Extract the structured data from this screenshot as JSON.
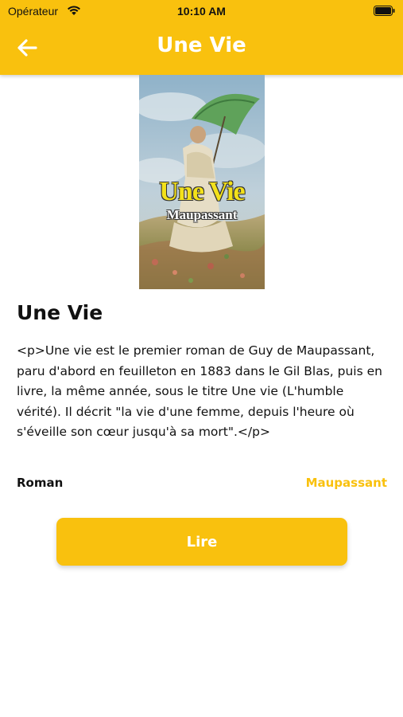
{
  "status_bar": {
    "carrier": "Opérateur",
    "time": "10:10 AM"
  },
  "nav": {
    "title": "Une Vie",
    "back_icon": "arrow-left-icon"
  },
  "cover": {
    "title": "Une Vie",
    "author": "Maupassant"
  },
  "book": {
    "title": "Une Vie",
    "description": "<p>Une vie est le premier roman de Guy de Maupassant, paru d'abord en feuilleton en 1883 dans le Gil Blas, puis en livre, la même année, sous le titre Une vie (L'humble vérité). Il décrit \"la vie d'une femme, depuis l'heure où s'éveille son cœur jusqu'à sa mort\".</p>",
    "genre": "Roman",
    "author": "Maupassant"
  },
  "actions": {
    "read_label": "Lire"
  },
  "colors": {
    "accent": "#F9C10E",
    "header_text": "#FFFFFF"
  }
}
